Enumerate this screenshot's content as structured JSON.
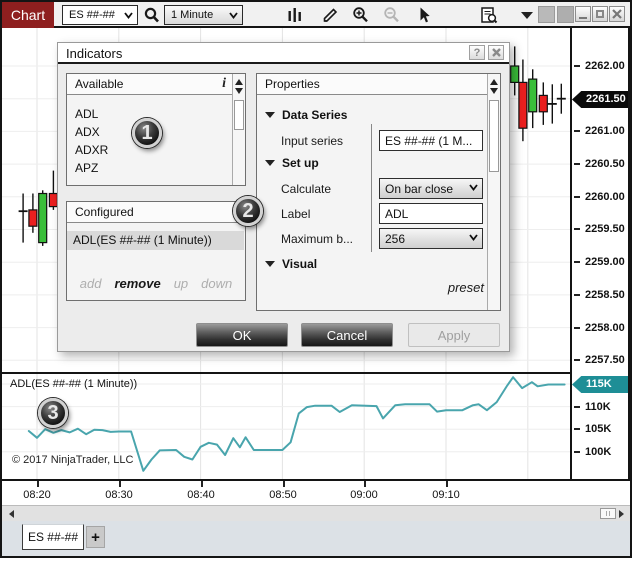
{
  "toolbar": {
    "app_tab": "Chart",
    "instrument": "ES ##-##",
    "interval": "1 Minute"
  },
  "dialog": {
    "title": "Indicators",
    "help_glyph": "?",
    "available": {
      "header": "Available",
      "info_glyph": "i",
      "items": [
        "ADL",
        "ADX",
        "ADXR",
        "APZ"
      ]
    },
    "configured": {
      "header": "Configured",
      "selected_item": "ADL(ES ##-## (1 Minute))",
      "actions": {
        "add": "add",
        "remove": "remove",
        "up": "up",
        "down": "down"
      }
    },
    "properties": {
      "header": "Properties",
      "sections": {
        "data_series": "Data Series",
        "set_up": "Set up",
        "visual": "Visual"
      },
      "fields": {
        "input_series_label": "Input series",
        "input_series_value": "ES ##-## (1 M...",
        "calculate_label": "Calculate",
        "calculate_value": "On bar close",
        "label_label": "Label",
        "label_value": "ADL",
        "maximum_label": "Maximum b...",
        "maximum_value": "256"
      },
      "preset": "preset"
    },
    "buttons": {
      "ok": "OK",
      "cancel": "Cancel",
      "apply": "Apply"
    }
  },
  "badges": {
    "one": "1",
    "two": "2",
    "three": "3"
  },
  "indicator_panel": {
    "title": "ADL(ES ##-## (1 Minute))",
    "copyright": "© 2017 NinjaTrader, LLC"
  },
  "price_axis": {
    "labels": [
      "2262.00",
      "2261.50",
      "2261.00",
      "2260.50",
      "2260.00",
      "2259.50",
      "2259.00",
      "2258.50",
      "2258.00",
      "2257.50"
    ],
    "highlight": "2261.50"
  },
  "indicator_axis": {
    "labels": [
      "110K",
      "105K",
      "100K"
    ],
    "highlight": "115K"
  },
  "time_axis": {
    "labels": [
      "08:20",
      "08:30",
      "08:40",
      "08:50",
      "09:00",
      "09:10"
    ]
  },
  "tabs": {
    "active": "ES ##-##",
    "add": "+"
  },
  "colors": {
    "accent_red": "#8e1f1f",
    "candle_up": "#3abf3a",
    "candle_down": "#ea1f1f",
    "adl_line": "#49a5ad",
    "adl_tag": "#1e8e96",
    "price_tag": "#0a0a0a"
  },
  "chart_data": [
    {
      "type": "candlestick",
      "title": "ES ##-## (1 Minute)",
      "x_unit": "minutes since 08:20",
      "y_axis": {
        "min": 2257.5,
        "max": 2262.0,
        "tick_step": 0.5,
        "last_price": 2261.5
      },
      "grid": true,
      "candles": [
        {
          "t": -1.7,
          "o": 2259.78,
          "h": 2260.05,
          "l": 2259.3,
          "c": 2259.78
        },
        {
          "t": -0.5,
          "o": 2259.8,
          "h": 2260.05,
          "l": 2259.45,
          "c": 2259.55
        },
        {
          "t": 0.7,
          "o": 2259.3,
          "h": 2260.1,
          "l": 2259.25,
          "c": 2260.05
        },
        {
          "t": 2.0,
          "o": 2260.05,
          "h": 2260.4,
          "l": 2259.8,
          "c": 2259.85
        },
        {
          "t": 58.4,
          "o": 2261.75,
          "h": 2262.3,
          "l": 2261.55,
          "c": 2262.0
        },
        {
          "t": 59.4,
          "o": 2261.75,
          "h": 2262.1,
          "l": 2260.85,
          "c": 2261.05
        },
        {
          "t": 60.6,
          "o": 2261.3,
          "h": 2261.95,
          "l": 2261.05,
          "c": 2261.8
        },
        {
          "t": 61.9,
          "o": 2261.55,
          "h": 2261.75,
          "l": 2261.1,
          "c": 2261.3
        },
        {
          "t": 63.0,
          "o": 2261.42,
          "h": 2261.72,
          "l": 2261.12,
          "c": 2261.42
        },
        {
          "t": 64.1,
          "o": 2261.5,
          "h": 2261.73,
          "l": 2261.27,
          "c": 2261.5
        }
      ]
    },
    {
      "type": "line",
      "name": "ADL(ES ##-## (1 Minute))",
      "x_unit": "minutes since 08:20",
      "y_axis": {
        "unit": "K",
        "ticks_k": [
          100,
          105,
          110,
          115
        ],
        "last_value_k": 115
      },
      "points": [
        [
          -1,
          104.6
        ],
        [
          0,
          103.1
        ],
        [
          1,
          105.0
        ],
        [
          2,
          104.2
        ],
        [
          3,
          104.8
        ],
        [
          4,
          104.3
        ],
        [
          5,
          105.1
        ],
        [
          6,
          103.9
        ],
        [
          7,
          104.9
        ],
        [
          8,
          104.8
        ],
        [
          9,
          104.4
        ],
        [
          10,
          104.5
        ],
        [
          11.5,
          104.5
        ],
        [
          13,
          95.8
        ],
        [
          14,
          98.3
        ],
        [
          15,
          100.3
        ],
        [
          17,
          100.4
        ],
        [
          18,
          98.9
        ],
        [
          19,
          98.3
        ],
        [
          20,
          101.1
        ],
        [
          21,
          102.0
        ],
        [
          22,
          101.6
        ],
        [
          23,
          99.3
        ],
        [
          24,
          103.0
        ],
        [
          24.8,
          101.0
        ],
        [
          25.5,
          103.2
        ],
        [
          26.5,
          100.4
        ],
        [
          30,
          100.4
        ],
        [
          31,
          102.1
        ],
        [
          32,
          108.5
        ],
        [
          33,
          109.9
        ],
        [
          34,
          110.2
        ],
        [
          36,
          110.2
        ],
        [
          37,
          108.8
        ],
        [
          38.5,
          110.3
        ],
        [
          41.5,
          110.1
        ],
        [
          42.3,
          107.4
        ],
        [
          43.8,
          110.3
        ],
        [
          45,
          110.5
        ],
        [
          48,
          110.5
        ],
        [
          48.9,
          108.9
        ],
        [
          50,
          109.2
        ],
        [
          52,
          109.2
        ],
        [
          53.3,
          110.3
        ],
        [
          54,
          110.5
        ],
        [
          55,
          109.2
        ],
        [
          56.2,
          111.0
        ],
        [
          57.5,
          114.7
        ],
        [
          58.2,
          116.5
        ],
        [
          59.3,
          114.1
        ],
        [
          60.5,
          115.4
        ],
        [
          61.2,
          114.5
        ],
        [
          62.5,
          114.9
        ],
        [
          64.5,
          114.9
        ]
      ]
    }
  ]
}
